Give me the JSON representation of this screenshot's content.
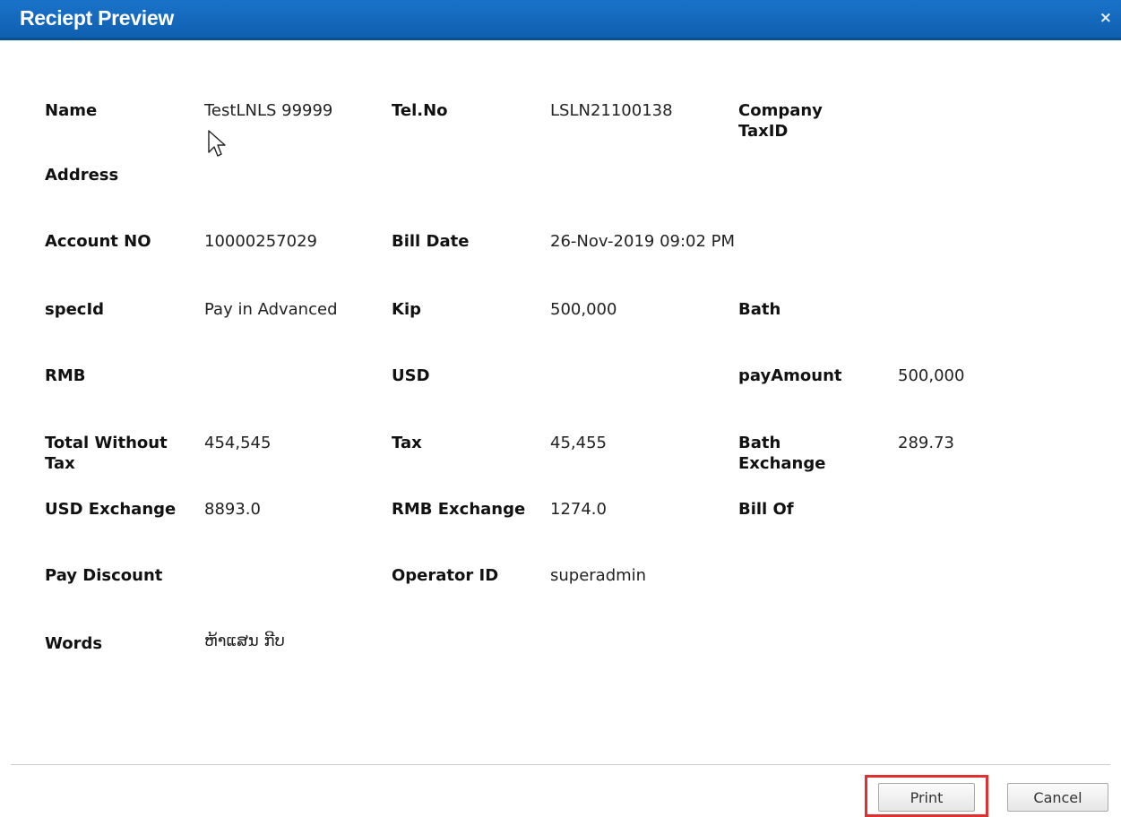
{
  "dialog": {
    "title": "Reciept Preview",
    "close_glyph": "×"
  },
  "fields": {
    "name": {
      "label": "Name",
      "value": "TestLNLS 99999"
    },
    "tel_no": {
      "label": "Tel.No",
      "value": "LSLN21100138"
    },
    "company_tax_id": {
      "label_line1": "Company",
      "label_line2": "TaxID",
      "value": ""
    },
    "address": {
      "label": "Address",
      "value": ""
    },
    "account_no": {
      "label": "Account NO",
      "value": "10000257029"
    },
    "bill_date": {
      "label": "Bill Date",
      "value": "26-Nov-2019 09:02 PM"
    },
    "spec_id": {
      "label": "specId",
      "value": "Pay in Advanced"
    },
    "kip": {
      "label": "Kip",
      "value": "500,000"
    },
    "bath": {
      "label": "Bath",
      "value": ""
    },
    "rmb": {
      "label": "RMB",
      "value": ""
    },
    "usd": {
      "label": "USD",
      "value": ""
    },
    "pay_amount": {
      "label": "payAmount",
      "value": "500,000"
    },
    "total_without_tax": {
      "label_line1": "Total Without",
      "label_line2": "Tax",
      "value": "454,545"
    },
    "tax": {
      "label": "Tax",
      "value": "45,455"
    },
    "bath_exchange": {
      "label_line1": "Bath",
      "label_line2": "Exchange",
      "value": "289.73"
    },
    "usd_exchange": {
      "label": "USD Exchange",
      "value": "8893.0"
    },
    "rmb_exchange": {
      "label": "RMB Exchange",
      "value": "1274.0"
    },
    "bill_of": {
      "label": "Bill Of",
      "value": ""
    },
    "pay_discount": {
      "label": "Pay Discount",
      "value": ""
    },
    "operator_id": {
      "label": "Operator ID",
      "value": "superadmin"
    },
    "words": {
      "label": "Words",
      "value": "ຫ້າແສນ ກີບ"
    }
  },
  "buttons": {
    "print": "Print",
    "cancel": "Cancel"
  },
  "colors": {
    "titlebar": "#1467bd",
    "highlight": "#e03030"
  },
  "icons": {
    "close": "close-icon",
    "cursor": "mouse-cursor-icon"
  }
}
